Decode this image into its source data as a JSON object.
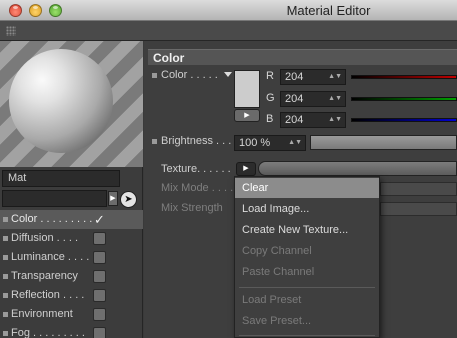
{
  "window": {
    "title": "Material Editor"
  },
  "material": {
    "name": "Mat"
  },
  "channels": [
    {
      "label": "Color . . . . . . . . .",
      "checked": true
    },
    {
      "label": "Diffusion  . . . .",
      "checked": false
    },
    {
      "label": "Luminance . . . .",
      "checked": false
    },
    {
      "label": "Transparency",
      "checked": false
    },
    {
      "label": "Reflection . . . .",
      "checked": false
    },
    {
      "label": "Environment",
      "checked": false
    },
    {
      "label": "Fog . . . . . . . . .",
      "checked": false
    }
  ],
  "checkmark": "✓",
  "section": {
    "title": "Color"
  },
  "color_prop": {
    "label": "Color . . . . .",
    "swatch_color": "#cccccc",
    "r_label": "R",
    "r_value": "204",
    "g_label": "G",
    "g_value": "204",
    "b_label": "B",
    "b_value": "204"
  },
  "brightness": {
    "label": "Brightness . . .",
    "value": "100 %"
  },
  "texture": {
    "label": "Texture. . . . . ."
  },
  "mix_mode": {
    "label": "Mix Mode . . . . ."
  },
  "mix_strength": {
    "label": "Mix Strength"
  },
  "menu": {
    "items": [
      {
        "label": "Clear",
        "state": "highlighted"
      },
      {
        "label": "Load Image...",
        "state": "enabled"
      },
      {
        "label": "Create New Texture...",
        "state": "enabled"
      },
      {
        "label": "Copy Channel",
        "state": "disabled"
      },
      {
        "label": "Paste Channel",
        "state": "disabled"
      },
      {
        "label": "Load Preset",
        "state": "disabled"
      },
      {
        "label": "Save Preset...",
        "state": "disabled"
      }
    ]
  },
  "colors": {
    "red_channel": "#c00000",
    "green_channel": "#00a000",
    "blue_channel": "#0000d0"
  }
}
